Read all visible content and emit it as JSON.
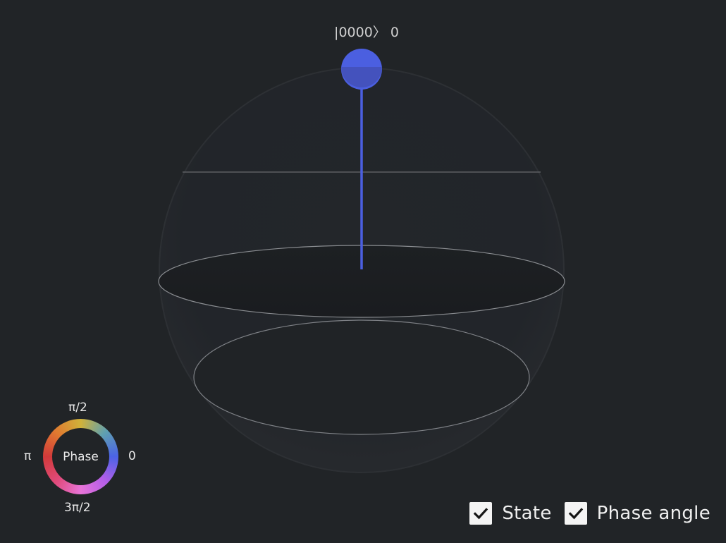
{
  "state_label": "|0000〉 0",
  "legend": {
    "center_label": "Phase",
    "tick_top": "π/2",
    "tick_left": "π",
    "tick_right": "0",
    "tick_bottom": "3π/2"
  },
  "controls": {
    "state_label": "State",
    "state_checked": true,
    "phase_label": "Phase angle",
    "phase_checked": true
  },
  "colors": {
    "background": "#212427",
    "state_vector": "#4b5fe0",
    "sphere_outline": "#3a3d41",
    "ring_outline": "#8a8d91"
  },
  "icons": {
    "checkbox": "checkmark-icon",
    "state": "qubit-state-marker",
    "phase": "phase-color-wheel"
  }
}
